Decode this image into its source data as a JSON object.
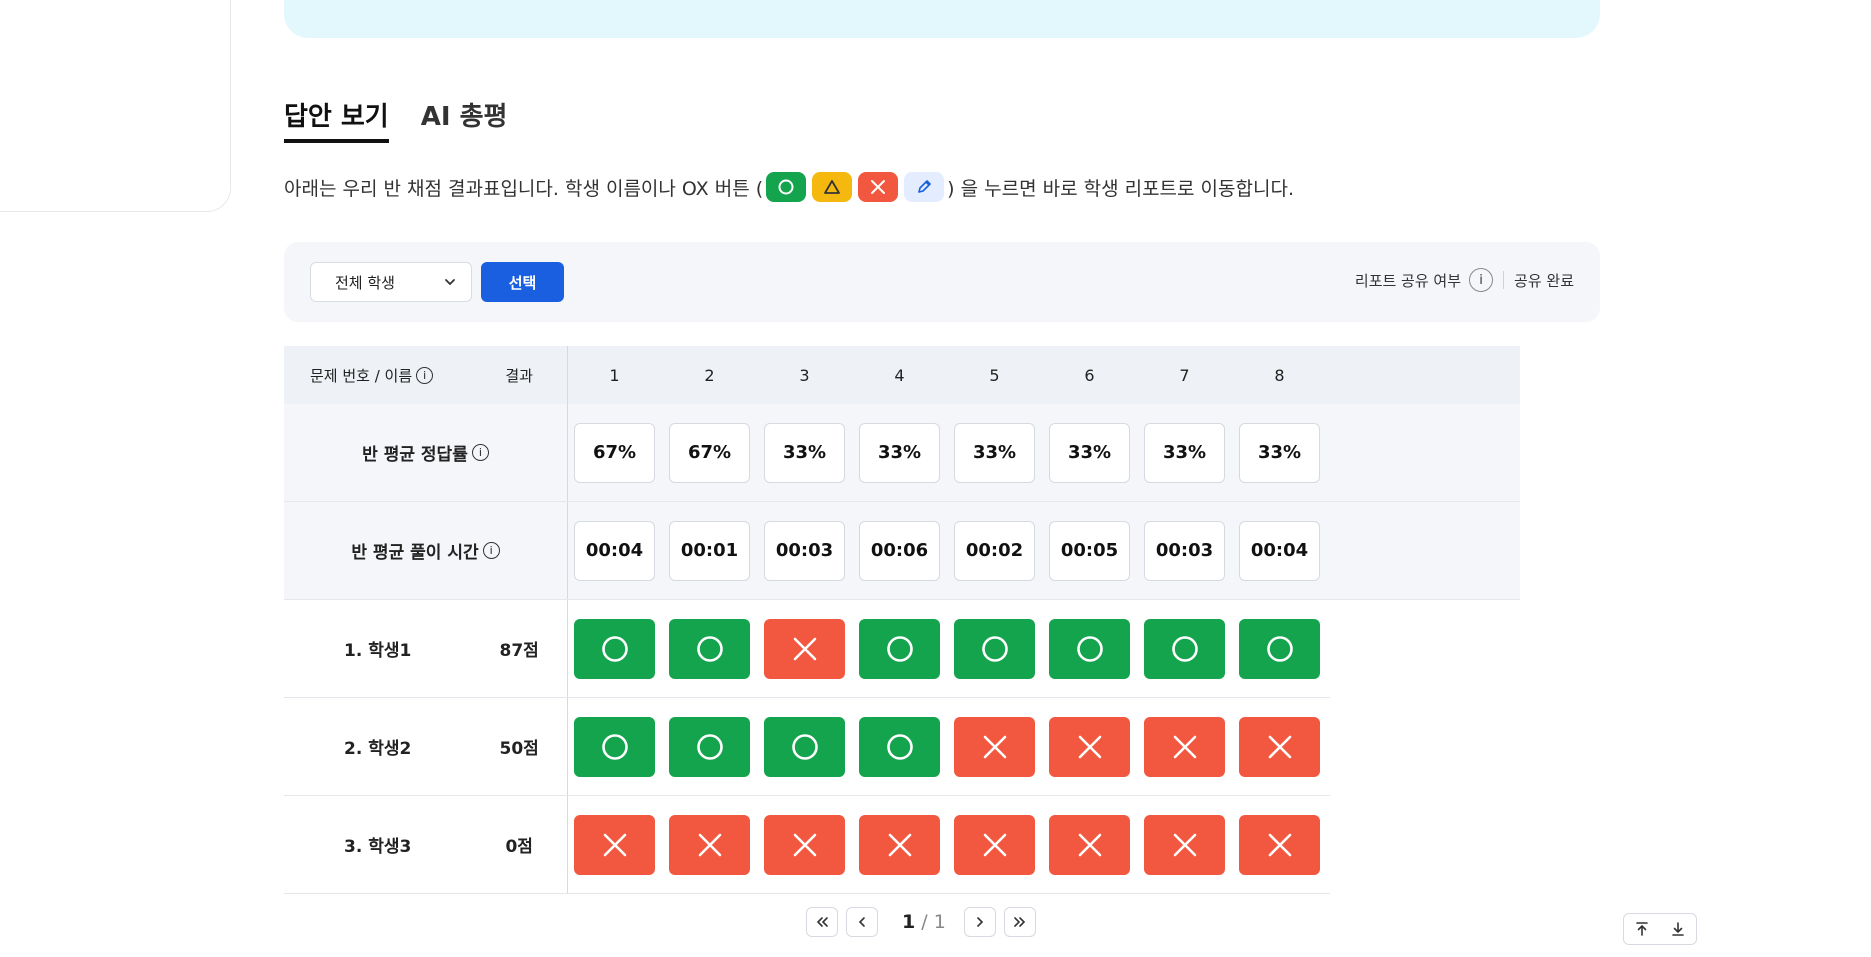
{
  "tabs": [
    {
      "label": "답안 보기",
      "active": true
    },
    {
      "label": "AI 총평",
      "active": false
    }
  ],
  "description": {
    "before": "아래는 우리 반 채점 결과표입니다. 학생 이름이나 OX 버튼 (",
    "after": ") 을 누르면 바로 학생 리포트로 이동합니다.",
    "chips": [
      "circle-icon",
      "triangle-icon",
      "x-icon",
      "pencil-icon"
    ]
  },
  "filter": {
    "select_value": "전체 학생",
    "select_button": "선택",
    "share_label": "리포트 공유 여부",
    "share_status": "공유 완료"
  },
  "table": {
    "header_name": "문제 번호 / 이름",
    "header_result": "결과",
    "questions": [
      "1",
      "2",
      "3",
      "4",
      "5",
      "6",
      "7",
      "8"
    ],
    "avg_rate_label": "반 평균 정답률",
    "avg_rate": [
      "67%",
      "67%",
      "33%",
      "33%",
      "33%",
      "33%",
      "33%",
      "33%"
    ],
    "avg_time_label": "반 평균 풀이 시간",
    "avg_time": [
      "00:04",
      "00:01",
      "00:03",
      "00:06",
      "00:02",
      "00:05",
      "00:03",
      "00:04"
    ],
    "students": [
      {
        "name": "1. 학생1",
        "score": "87점",
        "marks": [
          "O",
          "O",
          "X",
          "O",
          "O",
          "O",
          "O",
          "O"
        ]
      },
      {
        "name": "2. 학생2",
        "score": "50점",
        "marks": [
          "O",
          "O",
          "O",
          "O",
          "X",
          "X",
          "X",
          "X"
        ]
      },
      {
        "name": "3. 학생3",
        "score": "0점",
        "marks": [
          "X",
          "X",
          "X",
          "X",
          "X",
          "X",
          "X",
          "X"
        ]
      }
    ]
  },
  "pagination": {
    "current": "1",
    "separator": " / ",
    "total": "1"
  },
  "colors": {
    "correct": "#14a44d",
    "wrong": "#f25740",
    "primary": "#1a5fe0",
    "banner": "#e3f8fd"
  }
}
